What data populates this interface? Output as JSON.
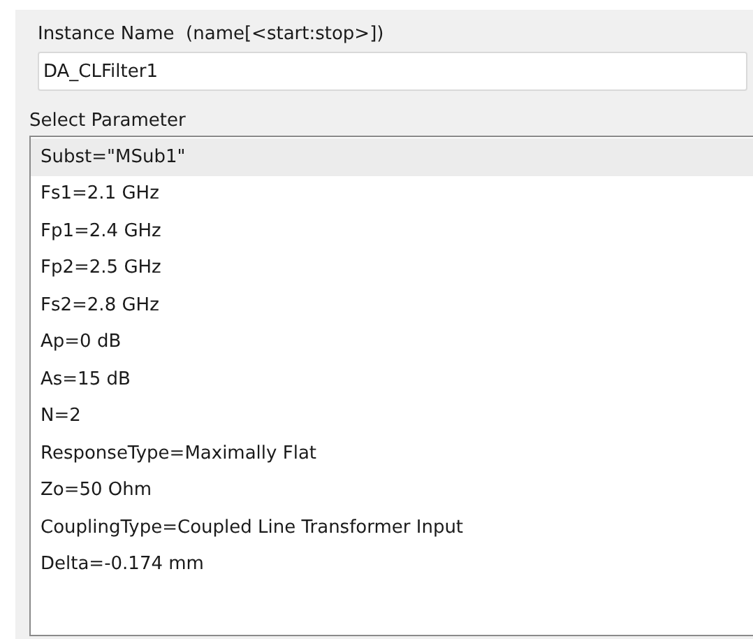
{
  "instance_name": {
    "label": "Instance Name  (name[<start:stop>])",
    "value": "DA_CLFilter1"
  },
  "parameter_list": {
    "label": "Select Parameter",
    "items": [
      {
        "text": "Subst=\"MSub1\"",
        "selected": true
      },
      {
        "text": "Fs1=2.1 GHz",
        "selected": false
      },
      {
        "text": "Fp1=2.4 GHz",
        "selected": false
      },
      {
        "text": "Fp2=2.5 GHz",
        "selected": false
      },
      {
        "text": "Fs2=2.8 GHz",
        "selected": false
      },
      {
        "text": "Ap=0 dB",
        "selected": false
      },
      {
        "text": "As=15 dB",
        "selected": false
      },
      {
        "text": "N=2",
        "selected": false
      },
      {
        "text": "ResponseType=Maximally Flat",
        "selected": false
      },
      {
        "text": "Zo=50 Ohm",
        "selected": false
      },
      {
        "text": "CouplingType=Coupled Line Transformer Input",
        "selected": false
      },
      {
        "text": "Delta=-0.174 mm",
        "selected": false
      }
    ]
  }
}
